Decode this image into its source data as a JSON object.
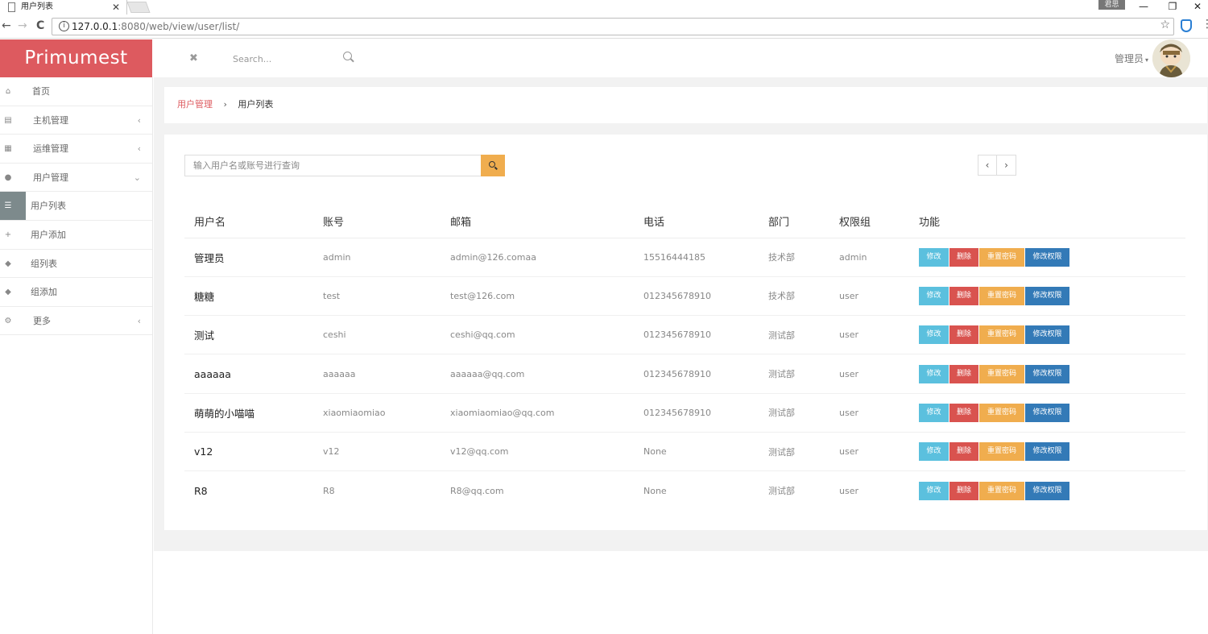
{
  "browser": {
    "tab_title": "用户列表",
    "tab_close": "✕",
    "profile_badge": "君思",
    "url_host": "127.0.0.1",
    "url_rest": ":8080/web/view/user/list/",
    "back": "←",
    "forward": "→",
    "reload": "C",
    "info": "i",
    "star": "☆",
    "kebab": "⋮",
    "minimize": "—",
    "restore": "❐",
    "close": "✕"
  },
  "header": {
    "brand": "Primumest",
    "expand_glyph": "✖",
    "search_placeholder": "Search...",
    "user_label": "管理员",
    "caret": "▾"
  },
  "sidebar": {
    "items": [
      {
        "label": "首页",
        "icon": "⌂",
        "chev": ""
      },
      {
        "label": "主机管理",
        "icon": "▤",
        "chev": "‹"
      },
      {
        "label": "运维管理",
        "icon": "▦",
        "chev": "‹"
      },
      {
        "label": "用户管理",
        "icon": "●",
        "chev": "⌄"
      },
      {
        "label": "用户列表",
        "icon": "☰",
        "chev": ""
      },
      {
        "label": "用户添加",
        "icon": "+",
        "chev": ""
      },
      {
        "label": "组列表",
        "icon": "◆",
        "chev": ""
      },
      {
        "label": "组添加",
        "icon": "◆",
        "chev": ""
      },
      {
        "label": "更多",
        "icon": "⚙",
        "chev": "‹"
      }
    ]
  },
  "breadcrumb": {
    "parent": "用户管理",
    "separator": "›",
    "current": "用户列表"
  },
  "query": {
    "placeholder": "输入用户名或账号进行查询"
  },
  "pager": {
    "prev": "‹",
    "next": "›"
  },
  "table": {
    "headers": [
      "用户名",
      "账号",
      "邮箱",
      "电话",
      "部门",
      "权限组",
      "功能"
    ],
    "actions": {
      "edit": "修改",
      "delete": "删除",
      "reset": "重置密码",
      "perm": "修改权限"
    },
    "rows": [
      {
        "name": "管理员",
        "account": "admin",
        "email": "admin@126.comaa",
        "phone": "15516444185",
        "dept": "技术部",
        "group": "admin"
      },
      {
        "name": "糖糖",
        "account": "test",
        "email": "test@126.com",
        "phone": "012345678910",
        "dept": "技术部",
        "group": "user"
      },
      {
        "name": "测试",
        "account": "ceshi",
        "email": "ceshi@qq.com",
        "phone": "012345678910",
        "dept": "测试部",
        "group": "user"
      },
      {
        "name": "aaaaaa",
        "account": "aaaaaa",
        "email": "aaaaaa@qq.com",
        "phone": "012345678910",
        "dept": "测试部",
        "group": "user"
      },
      {
        "name": "萌萌的小喵喵",
        "account": "xiaomiaomiao",
        "email": "xiaomiaomiao@qq.com",
        "phone": "012345678910",
        "dept": "测试部",
        "group": "user"
      },
      {
        "name": "v12",
        "account": "v12",
        "email": "v12@qq.com",
        "phone": "None",
        "dept": "测试部",
        "group": "user"
      },
      {
        "name": "R8",
        "account": "R8",
        "email": "R8@qq.com",
        "phone": "None",
        "dept": "测试部",
        "group": "user"
      }
    ]
  }
}
